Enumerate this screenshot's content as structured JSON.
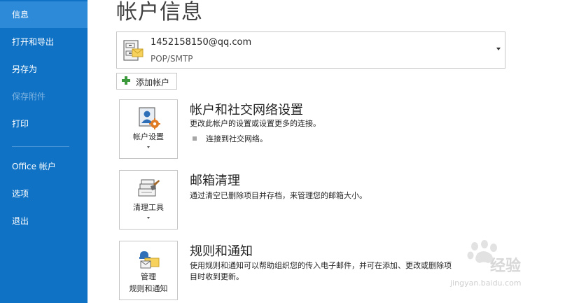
{
  "sidebar": {
    "items": [
      {
        "label": "信息",
        "state": "active"
      },
      {
        "label": "打开和导出",
        "state": "normal"
      },
      {
        "label": "另存为",
        "state": "normal"
      },
      {
        "label": "保存附件",
        "state": "disabled"
      },
      {
        "label": "打印",
        "state": "normal"
      },
      {
        "label": "Office 帐户",
        "state": "normal"
      },
      {
        "label": "选项",
        "state": "normal"
      },
      {
        "label": "退出",
        "state": "normal"
      }
    ]
  },
  "main": {
    "title": "帐户信息",
    "account": {
      "email": "1452158150@qq.com",
      "type": "POP/SMTP"
    },
    "add_account_label": "添加帐户",
    "sections": [
      {
        "button_label": "帐户设置",
        "title": "帐户和社交网络设置",
        "description": "更改此帐户的设置或设置更多的连接。",
        "link": "连接到社交网络。"
      },
      {
        "button_label": "清理工具",
        "title": "邮箱清理",
        "description": "通过清空已删除项目并存档，来管理您的邮箱大小。"
      },
      {
        "button_label_line1": "管理",
        "button_label_line2": "规则和通知",
        "title": "规则和通知",
        "description_line1": "使用规则和通知可以帮助组织您的传入电子邮件，并可在添加、更改或删除项",
        "description_line2": "目时收到更新。"
      }
    ]
  },
  "watermark": {
    "text1": "经验",
    "text2": "jingyan.baidu.com"
  },
  "colors": {
    "sidebar_bg": "#0f72c5",
    "sidebar_active": "#2d8ad8",
    "icon_orange": "#e07b25",
    "icon_blue": "#2e6fb8"
  }
}
